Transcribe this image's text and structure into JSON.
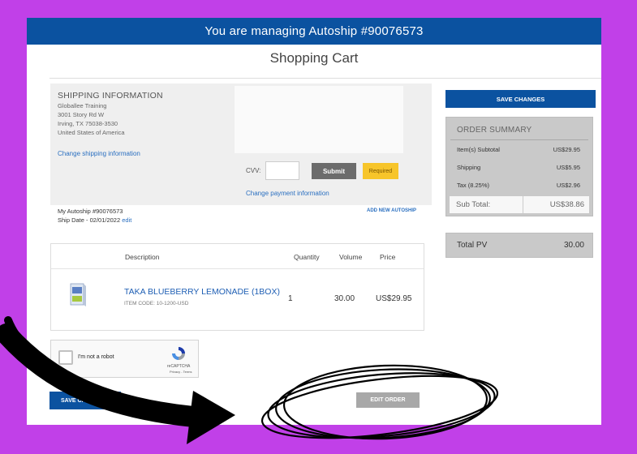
{
  "banner": {
    "text": "You are managing Autoship #90076573"
  },
  "page_title": "Shopping Cart",
  "shipping": {
    "heading": "SHIPPING INFORMATION",
    "address_lines": [
      "Globallee Training",
      "3001 Story Rd W",
      "Irving, TX 75038-3530",
      "United States of America"
    ],
    "change_link": "Change shipping information"
  },
  "payment": {
    "cvv_label": "CVV:",
    "cvv_value": "",
    "submit_label": "Submit",
    "required_label": "Required",
    "change_link": "Change payment information"
  },
  "autoship": {
    "number_line": "My Autoship #90076573",
    "ship_date_line": "Ship Date - 02/01/2022",
    "edit_label": "edit",
    "add_new_label": "ADD NEW AUTOSHIP"
  },
  "products": {
    "columns": [
      "Description",
      "Quantity",
      "Volume",
      "Price"
    ],
    "items": [
      {
        "name": "TAKA BLUEBERRY LEMONADE (1BOX)",
        "code": "ITEM CODE: 10-1200-USD",
        "quantity": "1",
        "volume": "30.00",
        "price": "US$29.95"
      }
    ]
  },
  "captcha": {
    "label": "I'm not a robot",
    "brand": "reCAPTCHA",
    "terms": "Privacy - Terms"
  },
  "buttons": {
    "save_changes_top": "SAVE CHANGES",
    "save_changes_bottom": "SAVE CHANGES",
    "edit_order": "EDIT ORDER"
  },
  "order_summary": {
    "heading": "ORDER SUMMARY",
    "rows": [
      {
        "label": "Item(s) Subtotal",
        "value": "US$29.95"
      },
      {
        "label": "Shipping",
        "value": "US$5.95"
      },
      {
        "label": "Tax (8.25%)",
        "value": "US$2.96"
      }
    ],
    "subtotal_label": "Sub Total:",
    "subtotal_value": "US$38.86"
  },
  "total_pv": {
    "label": "Total PV",
    "value": "30.00"
  },
  "colors": {
    "frame": "#c140e8",
    "primary": "#0b52a0",
    "link": "#2a6fc0",
    "required": "#f7c52a",
    "panel": "#c9c9c9"
  },
  "annotations": {
    "arrow_icon": "hand-drawn-arrow-icon",
    "circle_icon": "hand-drawn-circle-icon"
  }
}
